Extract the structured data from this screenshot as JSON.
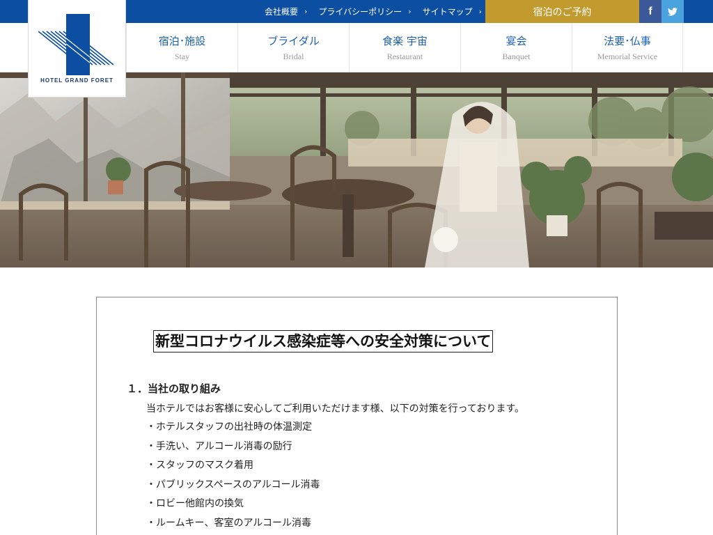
{
  "brand": {
    "logo_text": "HOTEL GRAND FORET"
  },
  "topbar": {
    "links": [
      {
        "label": "会社概要"
      },
      {
        "label": "プライバシーポリシー"
      },
      {
        "label": "サイトマップ"
      }
    ],
    "reserve_label": "宿泊のご予約",
    "facebook_glyph": "f",
    "colors": {
      "bar": "#0b4ea2",
      "reserve": "#c39a2e",
      "facebook": "#3b5998",
      "twitter": "#4aa3df"
    }
  },
  "nav": {
    "items": [
      {
        "jp": "宿泊･施設",
        "en": "Stay"
      },
      {
        "jp": "ブライダル",
        "en": "Bridal"
      },
      {
        "jp": "食楽 宇宙",
        "en": "Restaurant"
      },
      {
        "jp": "宴会",
        "en": "Banquet"
      },
      {
        "jp": "法要･仏事",
        "en": "Memorial Service"
      }
    ]
  },
  "notice": {
    "title": "新型コロナウイルス感染症等への安全対策について",
    "section1": {
      "heading": "１．当社の取り組み",
      "intro": "当ホテルではお客様に安心してご利用いただけます様、以下の対策を行っております。",
      "items": [
        "ホテルスタッフの出社時の体温測定",
        "手洗い、アルコール消毒の励行",
        "スタッフのマスク着用",
        "パブリックスペースのアルコール消毒",
        "ロビー他館内の換気",
        "ルームキー、客室のアルコール消毒"
      ]
    }
  }
}
